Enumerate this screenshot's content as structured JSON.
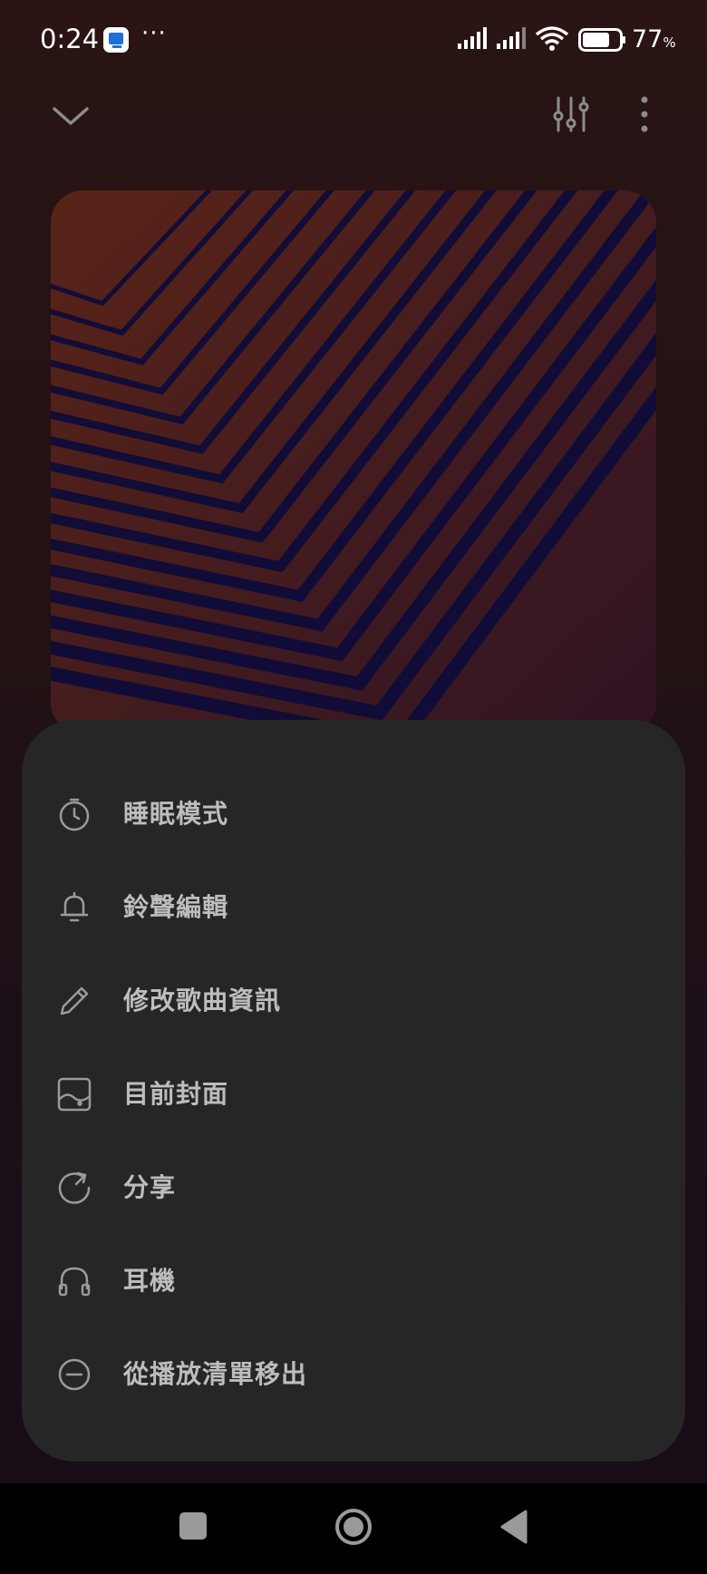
{
  "status_bar": {
    "time": "0:24",
    "battery_percent": "77",
    "battery_unit": "%",
    "battery_level": 0.77,
    "app_badge_icon": "desktop-app-icon",
    "overflow_icon": "ellipsis-icon"
  },
  "top_bar": {
    "collapse_icon": "chevron-down-icon",
    "equalizer_icon": "equalizer-sliders-icon",
    "more_icon": "vertical-dots-icon"
  },
  "album_art": {
    "colors": [
      "#5a2418",
      "#2f1424",
      "#0b0b3a"
    ]
  },
  "menu": {
    "items": [
      {
        "icon": "timer-icon",
        "label": "睡眠模式"
      },
      {
        "icon": "bell-icon",
        "label": "鈴聲編輯"
      },
      {
        "icon": "pencil-icon",
        "label": "修改歌曲資訊"
      },
      {
        "icon": "image-icon",
        "label": "目前封面"
      },
      {
        "icon": "share-icon",
        "label": "分享"
      },
      {
        "icon": "headphones-icon",
        "label": "耳機"
      },
      {
        "icon": "minus-circle-icon",
        "label": "從播放清單移出"
      }
    ]
  },
  "nav_bar": {
    "recents_icon": "square-icon",
    "home_icon": "circle-icon",
    "back_icon": "triangle-back-icon"
  }
}
